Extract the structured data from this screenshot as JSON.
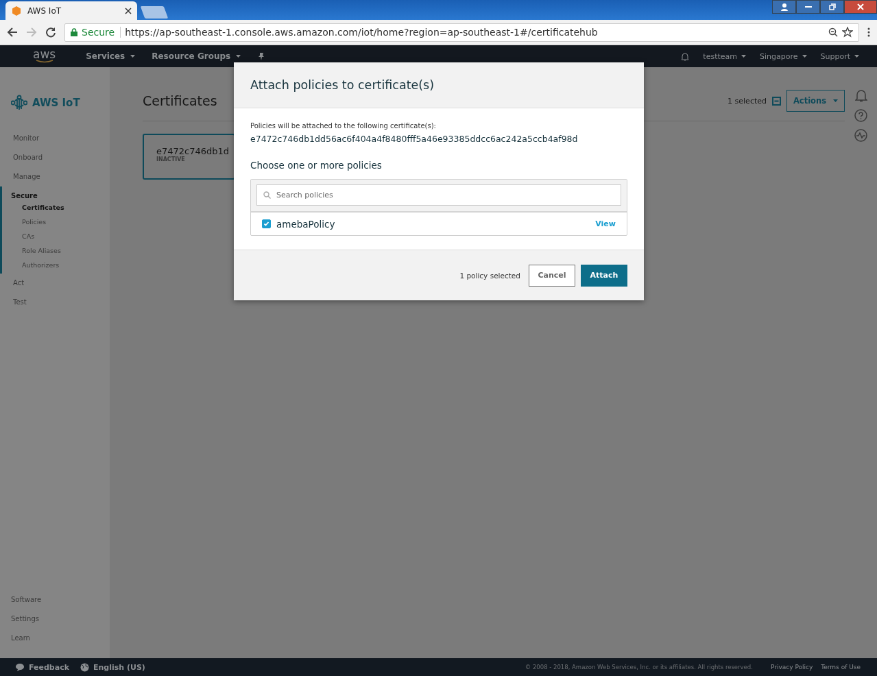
{
  "browser": {
    "tab_title": "AWS IoT",
    "secure_label": "Secure",
    "url": "https://ap-southeast-1.console.aws.amazon.com/iot/home?region=ap-southeast-1#/certificatehub"
  },
  "nav": {
    "logo": "aws",
    "menus": [
      {
        "label": "Services"
      },
      {
        "label": "Resource Groups"
      }
    ],
    "right_menus": [
      {
        "label": "testteam"
      },
      {
        "label": "Singapore"
      },
      {
        "label": "Support"
      }
    ]
  },
  "sidebar": {
    "title": "AWS IoT",
    "sections": [
      {
        "label": "Monitor",
        "selected": false
      },
      {
        "label": "Onboard",
        "selected": false
      },
      {
        "label": "Manage",
        "selected": false
      },
      {
        "label": "Secure",
        "selected": true,
        "children": [
          {
            "label": "Certificates",
            "selected": true
          },
          {
            "label": "Policies",
            "selected": false
          },
          {
            "label": "CAs",
            "selected": false
          },
          {
            "label": "Role Aliases",
            "selected": false
          },
          {
            "label": "Authorizers",
            "selected": false
          }
        ]
      },
      {
        "label": "Act",
        "selected": false
      },
      {
        "label": "Test",
        "selected": false
      }
    ],
    "bottom_items": [
      {
        "label": "Software"
      },
      {
        "label": "Settings"
      },
      {
        "label": "Learn"
      }
    ]
  },
  "page": {
    "title": "Certificates",
    "selected_count": "1 selected",
    "actions_button": "Actions",
    "cards": [
      {
        "id": "e7472c746db1d",
        "status": "INACTIVE",
        "selected": true
      }
    ]
  },
  "modal": {
    "title": "Attach policies to certificate(s)",
    "intro": "Policies will be attached to the following certificate(s):",
    "certificate_id": "e7472c746db1dd56ac6f404a4f8480fff5a46e93385ddcc6ac242a5ccb4af98d",
    "choose_label": "Choose one or more policies",
    "search": {
      "placeholder": "Search policies"
    },
    "policies": [
      {
        "name": "amebaPolicy",
        "checked": true,
        "link": "View"
      }
    ],
    "footer_count": "1 policy selected",
    "cancel_button": "Cancel",
    "attach_button": "Attach"
  },
  "footer": {
    "feedback": "Feedback",
    "language": "English (US)",
    "copyright": "© 2008 - 2018, Amazon Web Services, Inc. or its affiliates. All rights reserved.",
    "links": [
      "Privacy Policy",
      "Terms of Use"
    ]
  }
}
